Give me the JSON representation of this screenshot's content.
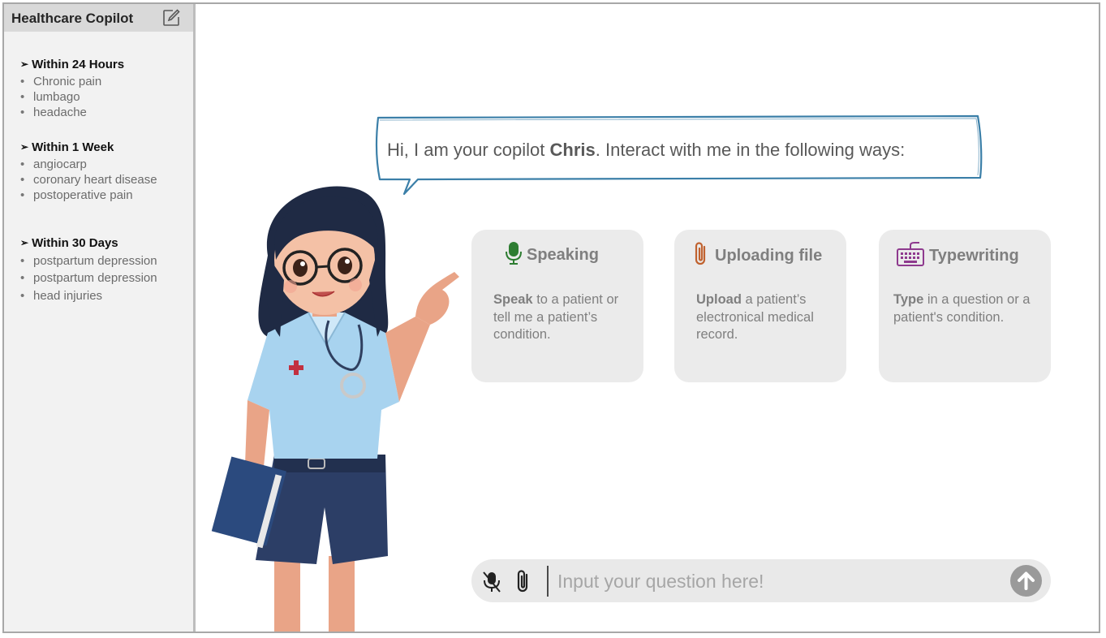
{
  "sidebar": {
    "title": "Healthcare Copilot",
    "new_chat_icon": "edit-icon",
    "groups": [
      {
        "title": "Within 24 Hours",
        "items": [
          "Chronic pain",
          "lumbago",
          "headache"
        ]
      },
      {
        "title": "Within 1 Week",
        "items": [
          "angiocarp",
          "coronary heart disease",
          "postoperative pain"
        ]
      },
      {
        "title": "Within 30 Days",
        "items": [
          "postpartum depression",
          "postpartum depression",
          "head injuries"
        ]
      }
    ]
  },
  "greeting": {
    "prefix": "Hi, I am your copilot ",
    "name": "Chris",
    "suffix": ". Interact with me in the following ways:"
  },
  "cards": [
    {
      "title": "Speaking",
      "icon": "microphone-icon",
      "icon_color": "#2e7d32",
      "desc_bold": "Speak",
      "desc_rest": " to a patient or tell me a patient’s condition."
    },
    {
      "title": "Uploading file",
      "icon": "paperclip-icon",
      "icon_color": "#c0622f",
      "desc_bold": "Upload",
      "desc_rest": " a patient’s electronical medical record."
    },
    {
      "title": "Typewriting",
      "icon": "keyboard-icon",
      "icon_color": "#8e3a8e",
      "desc_bold": "Type",
      "desc_rest": " in a question or a patient's condition."
    }
  ],
  "input": {
    "placeholder": "Input your question here!",
    "mic_icon": "mic-off-icon",
    "attach_icon": "paperclip-icon",
    "send_icon": "arrow-up-icon"
  },
  "colors": {
    "sidebar_bg": "#f2f2f2",
    "header_bg": "#d9d9d9",
    "card_bg": "#ebebeb",
    "bubble_border": "#3b7fa8",
    "send_button": "#9a9a9a"
  }
}
